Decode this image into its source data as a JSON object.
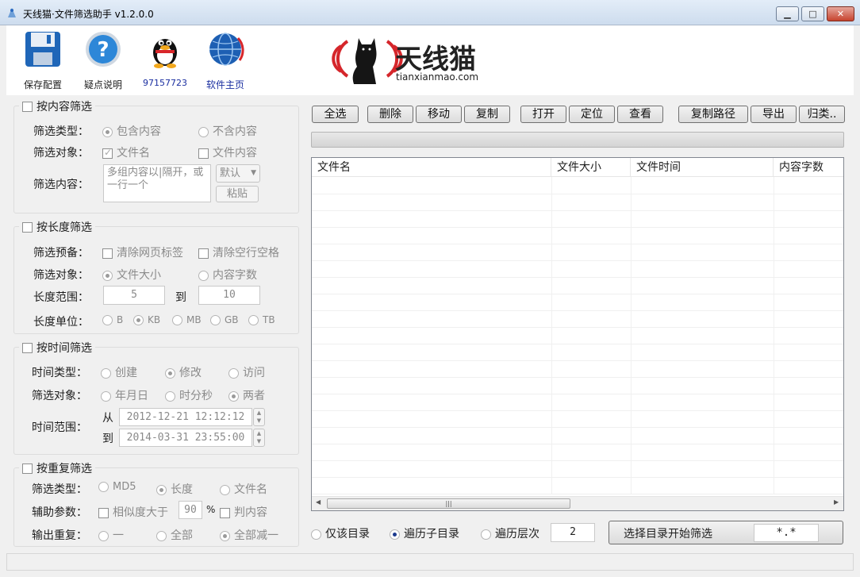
{
  "window": {
    "title": "天线猫·文件筛选助手 v1.2.0.0",
    "min_label": "▁",
    "max_label": "□",
    "close_label": "✕"
  },
  "toolbar": {
    "save_label": "保存配置",
    "help_label": "疑点说明",
    "qq_label": "97157723",
    "home_label": "软件主页",
    "logo_cn": "天线猫",
    "logo_en": "tianxianmao.com"
  },
  "content_filter": {
    "title": "按内容筛选",
    "type_label": "筛选类型：",
    "type_opt1": "包含内容",
    "type_opt2": "不含内容",
    "target_label": "筛选对象：",
    "target_opt1": "文件名",
    "target_opt2": "文件内容",
    "content_label": "筛选内容：",
    "content_value": "多组内容以|隔开，或一行一个",
    "default_select": "默认",
    "paste_button": "粘贴"
  },
  "length_filter": {
    "title": "按长度筛选",
    "prep_label": "筛选预备：",
    "prep_opt1": "清除网页标签",
    "prep_opt2": "清除空行空格",
    "target_label": "筛选对象：",
    "target_opt1": "文件大小",
    "target_opt2": "内容字数",
    "range_label": "长度范围：",
    "range_from": "5",
    "range_to_label": "到",
    "range_to": "10",
    "unit_label": "长度单位：",
    "units": [
      "B",
      "KB",
      "MB",
      "GB",
      "TB"
    ]
  },
  "time_filter": {
    "title": "按时间筛选",
    "type_label": "时间类型：",
    "type_opts": [
      "创建",
      "修改",
      "访问"
    ],
    "target_label": "筛选对象：",
    "target_opts": [
      "年月日",
      "时分秒",
      "两者"
    ],
    "range_label": "时间范围：",
    "from_label": "从",
    "from_value": "2012-12-21 12:12:12",
    "to_label": "到",
    "to_value": "2014-03-31 23:55:00"
  },
  "dup_filter": {
    "title": "按重复筛选",
    "type_label": "筛选类型：",
    "type_opts": [
      "MD5",
      "长度",
      "文件名"
    ],
    "aux_label": "辅助参数：",
    "similarity_label": "相似度大于",
    "similarity_value": "90",
    "percent": "%",
    "judge_content": "判内容",
    "output_label": "输出重复：",
    "output_opts": [
      "一",
      "全部",
      "全部减一"
    ]
  },
  "actions": {
    "select_all": "全选",
    "delete": "删除",
    "move": "移动",
    "copy": "复制",
    "open": "打开",
    "locate": "定位",
    "view": "查看",
    "copy_path": "复制路径",
    "export": "导出",
    "classify": "归类.."
  },
  "table": {
    "columns": [
      "文件名",
      "文件大小",
      "文件时间",
      "内容字数"
    ],
    "rows": []
  },
  "scope": {
    "only_dir": "仅该目录",
    "recursive": "遍历子目录",
    "depth_label": "遍历层次",
    "depth_value": "2",
    "start_button": "选择目录开始筛选",
    "pattern": "*.*"
  },
  "colors": {
    "accent": "#1c3a8e",
    "logo_red": "#d5262b"
  }
}
